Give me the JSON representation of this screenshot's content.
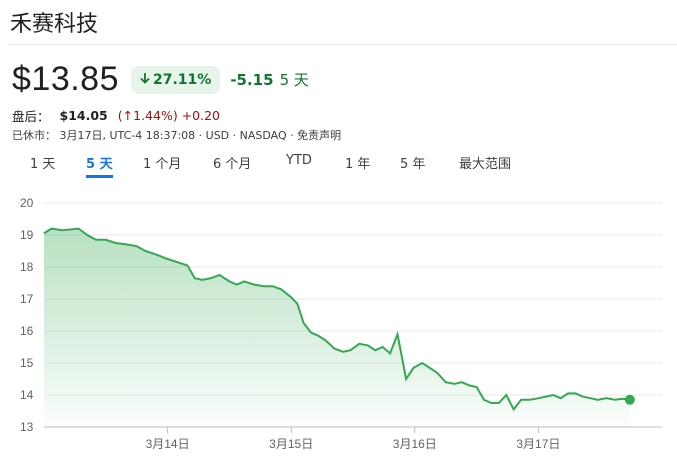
{
  "header": {
    "title": "禾赛科技"
  },
  "quote": {
    "price": "$13.85",
    "change_pct": "27.11%",
    "change_abs": "-5.15",
    "period": "5 天",
    "trend_color": "#137333"
  },
  "after_hours": {
    "label": "盘后：",
    "price": "$14.05",
    "change_pct": "(↑1.44%)",
    "change_abs": "+0.20"
  },
  "meta": {
    "text": "已休市： 3月17日, UTC-4 18:37:08 · USD · NASDAQ · 免责声明"
  },
  "tabs": [
    {
      "label": "1 天",
      "active": false
    },
    {
      "label": "5 天",
      "active": true
    },
    {
      "label": "1 个月",
      "active": false
    },
    {
      "label": "6 个月",
      "active": false
    },
    {
      "label": "YTD",
      "active": false
    },
    {
      "label": "1 年",
      "active": false
    },
    {
      "label": "5 年",
      "active": false
    },
    {
      "label": "最大范围",
      "active": false
    }
  ],
  "chart_data": {
    "type": "area",
    "ylim": [
      13,
      20
    ],
    "y_ticks": [
      20,
      19,
      18,
      17,
      16,
      15,
      14,
      13
    ],
    "x_tick_labels": [
      "3月14日",
      "3月15日",
      "3月16日",
      "3月17日"
    ],
    "x_tick_positions": [
      1,
      2,
      3,
      4
    ],
    "xlim": [
      0,
      5
    ],
    "line_color": "#34a853",
    "series": [
      {
        "values": [
          [
            0.0,
            19.05
          ],
          [
            0.06,
            19.2
          ],
          [
            0.15,
            19.15
          ],
          [
            0.28,
            19.2
          ],
          [
            0.35,
            19.0
          ],
          [
            0.42,
            18.85
          ],
          [
            0.5,
            18.85
          ],
          [
            0.58,
            18.75
          ],
          [
            0.68,
            18.7
          ],
          [
            0.75,
            18.65
          ],
          [
            0.82,
            18.5
          ],
          [
            0.9,
            18.4
          ],
          [
            1.0,
            18.25
          ],
          [
            1.08,
            18.15
          ],
          [
            1.16,
            18.05
          ],
          [
            1.22,
            17.65
          ],
          [
            1.28,
            17.6
          ],
          [
            1.35,
            17.65
          ],
          [
            1.42,
            17.75
          ],
          [
            1.5,
            17.55
          ],
          [
            1.56,
            17.45
          ],
          [
            1.62,
            17.55
          ],
          [
            1.7,
            17.45
          ],
          [
            1.78,
            17.4
          ],
          [
            1.85,
            17.4
          ],
          [
            1.92,
            17.3
          ],
          [
            2.0,
            17.05
          ],
          [
            2.05,
            16.85
          ],
          [
            2.1,
            16.25
          ],
          [
            2.16,
            15.95
          ],
          [
            2.22,
            15.85
          ],
          [
            2.28,
            15.7
          ],
          [
            2.35,
            15.45
          ],
          [
            2.42,
            15.35
          ],
          [
            2.48,
            15.4
          ],
          [
            2.55,
            15.6
          ],
          [
            2.62,
            15.55
          ],
          [
            2.68,
            15.4
          ],
          [
            2.74,
            15.5
          ],
          [
            2.8,
            15.3
          ],
          [
            2.86,
            15.9
          ],
          [
            2.93,
            14.5
          ],
          [
            2.99,
            14.85
          ],
          [
            3.06,
            15.0
          ],
          [
            3.12,
            14.85
          ],
          [
            3.18,
            14.7
          ],
          [
            3.25,
            14.4
          ],
          [
            3.32,
            14.35
          ],
          [
            3.38,
            14.4
          ],
          [
            3.44,
            14.3
          ],
          [
            3.5,
            14.25
          ],
          [
            3.56,
            13.85
          ],
          [
            3.62,
            13.75
          ],
          [
            3.68,
            13.75
          ],
          [
            3.74,
            14.0
          ],
          [
            3.8,
            13.55
          ],
          [
            3.86,
            13.85
          ],
          [
            3.93,
            13.85
          ],
          [
            4.0,
            13.9
          ],
          [
            4.06,
            13.95
          ],
          [
            4.12,
            14.0
          ],
          [
            4.18,
            13.9
          ],
          [
            4.24,
            14.05
          ],
          [
            4.3,
            14.05
          ],
          [
            4.36,
            13.95
          ],
          [
            4.42,
            13.9
          ],
          [
            4.48,
            13.85
          ],
          [
            4.55,
            13.9
          ],
          [
            4.62,
            13.85
          ],
          [
            4.68,
            13.88
          ],
          [
            4.74,
            13.85
          ]
        ]
      }
    ]
  }
}
